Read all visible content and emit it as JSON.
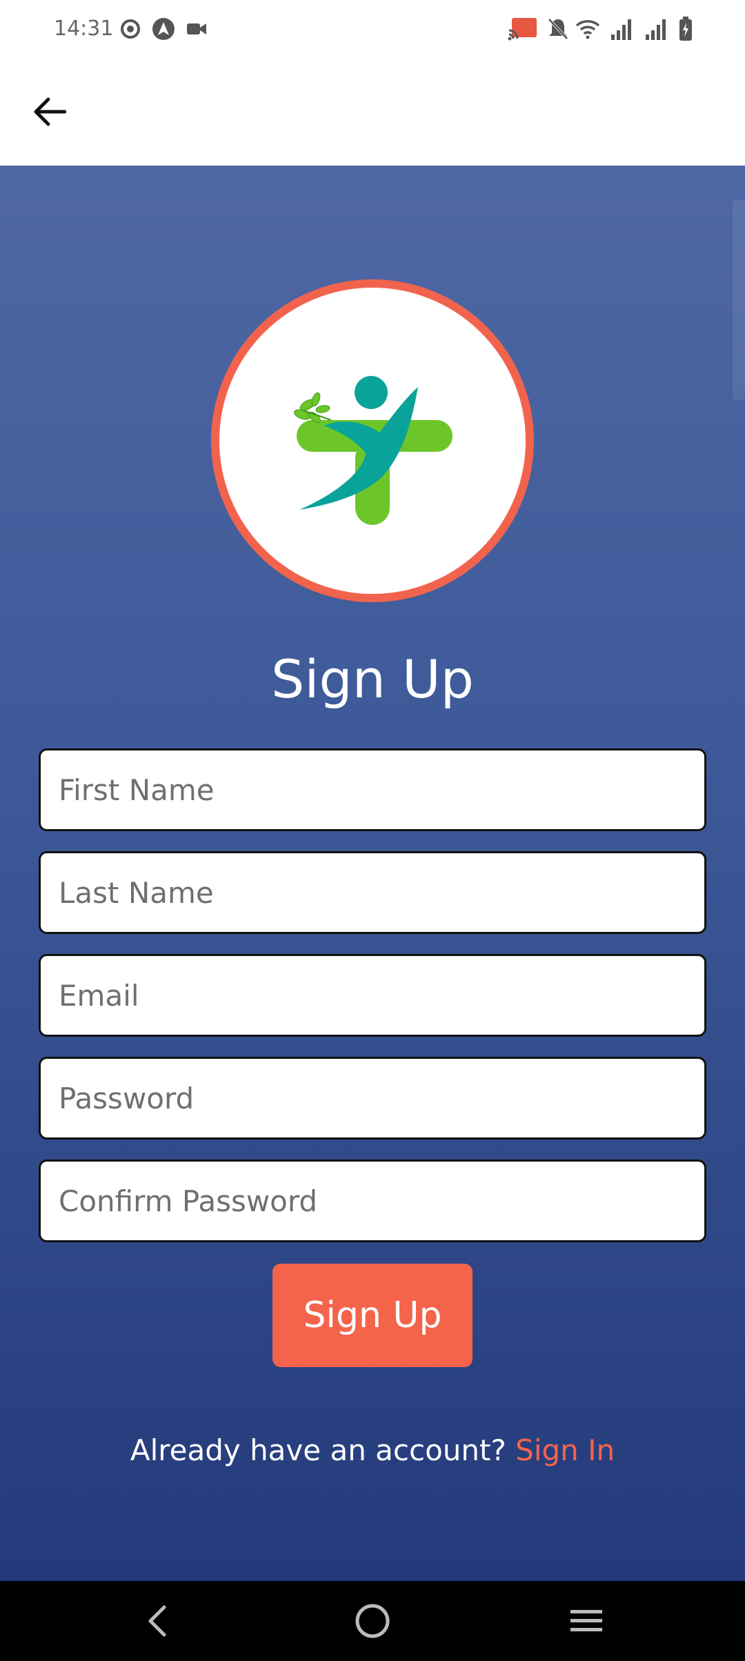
{
  "status_bar": {
    "time": "14:31",
    "left_icons": [
      "status-circle-icon",
      "nav-app-icon",
      "video-icon"
    ],
    "right_icons": [
      "cast-icon",
      "mute-icon",
      "wifi-icon",
      "signal-icon",
      "signal-icon",
      "battery-icon"
    ]
  },
  "app_bar": {
    "back_icon": "arrow-left-icon"
  },
  "logo": {
    "ring_color": "#f2634d",
    "figure_color": "#0aa39a",
    "cross_color": "#6cc62a"
  },
  "form": {
    "title": "Sign Up",
    "fields": {
      "first_name": {
        "placeholder": "First Name",
        "value": ""
      },
      "last_name": {
        "placeholder": "Last Name",
        "value": ""
      },
      "email": {
        "placeholder": "Email",
        "value": ""
      },
      "password": {
        "placeholder": "Password",
        "value": ""
      },
      "confirm_password": {
        "placeholder": "Confirm Password",
        "value": ""
      }
    },
    "submit_label": "Sign Up",
    "signin_prompt": "Already have an account?",
    "signin_link": "Sign In"
  },
  "colors": {
    "accent": "#f4644a",
    "background_top": "#4f68a4",
    "background_bottom": "#243a7a"
  },
  "nav_bar": {
    "icons": [
      "back-triangle-icon",
      "home-circle-icon",
      "recents-menu-icon"
    ]
  }
}
